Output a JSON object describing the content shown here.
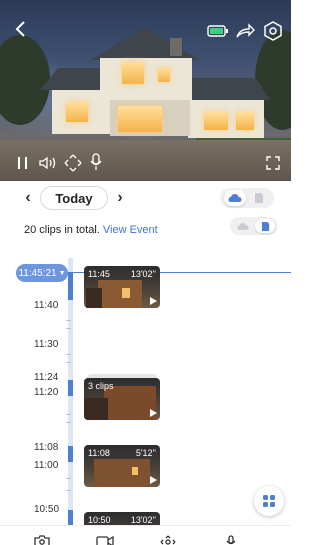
{
  "video": {
    "controls": {
      "back_icon": "chevron-left-icon",
      "battery_icon": "battery-icon",
      "share_icon": "share-icon",
      "settings_icon": "settings-icon",
      "pause_icon": "pause-icon",
      "volume_icon": "volume-icon",
      "ptz_icon": "ptz-direction-icon",
      "mic_icon": "microphone-icon",
      "fullscreen_icon": "fullscreen-icon"
    }
  },
  "date_nav": {
    "prev": "‹",
    "label": "Today",
    "next": "›"
  },
  "storage_toggle": {
    "options": [
      "cloud",
      "sd-card"
    ],
    "selected": "cloud"
  },
  "view_toggle": {
    "options": [
      "cloud",
      "local"
    ],
    "selected": "local"
  },
  "clips_info": {
    "text": "20 clips in total.",
    "link": "View Event"
  },
  "timeline": {
    "current_time": "11:45:21",
    "labels": [
      "11:40",
      "11:30",
      "11:24",
      "11:20",
      "11:08",
      "11:00",
      "10:50"
    ],
    "clips": [
      {
        "start": "11:45",
        "duration": "13'02''"
      },
      {
        "start": "3 clips",
        "duration": ""
      },
      {
        "start": "11:08",
        "duration": "5'12''"
      },
      {
        "start": "10:50",
        "duration": "13'02''"
      }
    ]
  },
  "colors": {
    "accent": "#4f7fd2",
    "link": "#3f72d6",
    "badge": "#6d96de"
  },
  "bottom_bar": {
    "icons": [
      "camera-icon",
      "video-record-icon",
      "ptz-icon",
      "microphone-icon"
    ]
  },
  "fab_icon": "grid-icon"
}
